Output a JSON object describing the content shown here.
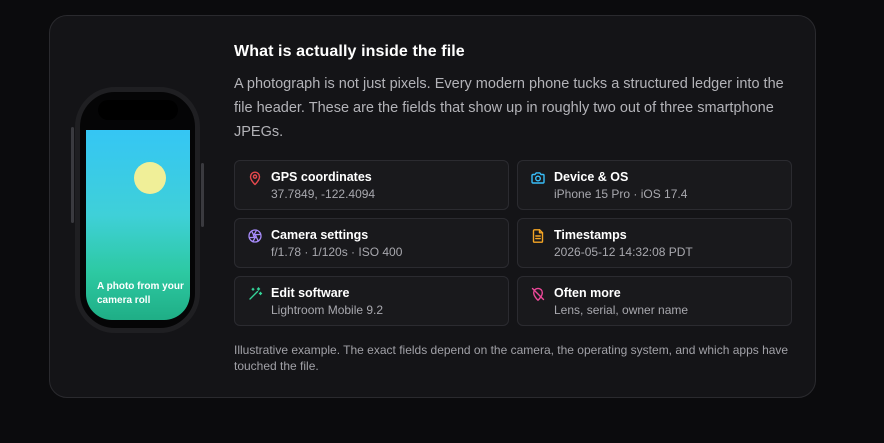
{
  "section": {
    "title": "What is actually inside the file",
    "description": "A photograph is not just pixels. Every modern phone tucks a structured ledger into the file header. These are the fields that show up in roughly two out of three smartphone JPEGs.",
    "footnote": "Illustrative example. The exact fields depend on the camera, the operating system, and which apps have touched the file."
  },
  "phone": {
    "caption": "A photo from your camera roll"
  },
  "fields": [
    {
      "label": "GPS coordinates",
      "value": "37.7849, -122.4094",
      "icon": "map-pin-icon",
      "color": "#e5484d"
    },
    {
      "label": "Device & OS",
      "value": "iPhone 15 Pro · iOS 17.4",
      "icon": "camera-icon",
      "color": "#38bdf8"
    },
    {
      "label": "Camera settings",
      "value": "f/1.78 · 1/120s · ISO 400",
      "icon": "aperture-icon",
      "color": "#a78bfa"
    },
    {
      "label": "Timestamps",
      "value": "2026-05-12 14:32:08 PDT",
      "icon": "document-icon",
      "color": "#f5a524"
    },
    {
      "label": "Edit software",
      "value": "Lightroom Mobile 9.2",
      "icon": "wand-icon",
      "color": "#34d399"
    },
    {
      "label": "Often more",
      "value": "Lens, serial, owner name",
      "icon": "hidden-icon",
      "color": "#ec4899"
    }
  ]
}
